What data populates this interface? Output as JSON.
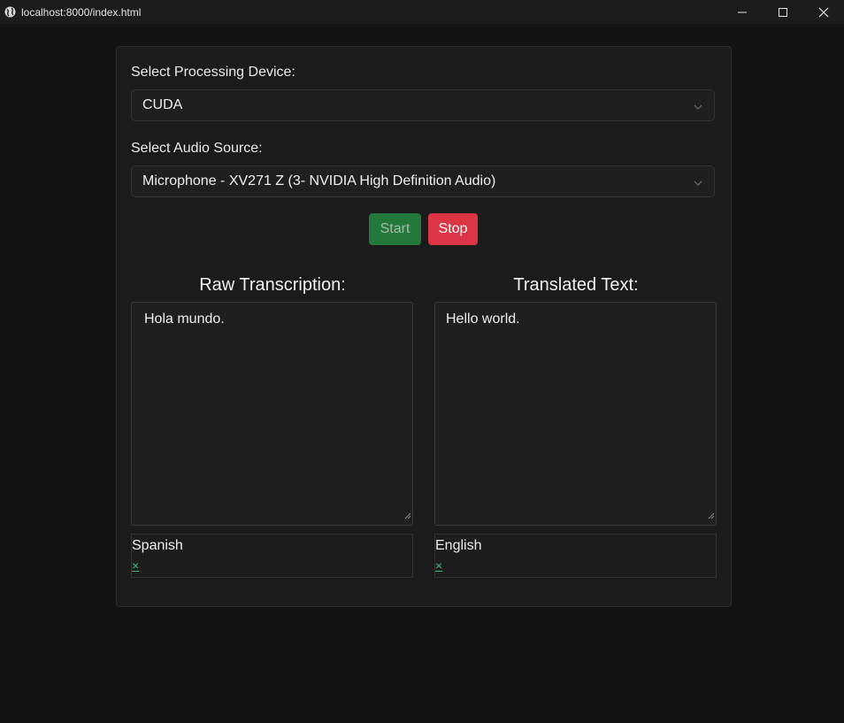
{
  "window": {
    "title": "localhost:8000/index.html",
    "icon": "globe-icon"
  },
  "device": {
    "label": "Select Processing Device:",
    "selected": "CUDA"
  },
  "audio": {
    "label": "Select Audio Source:",
    "selected": "Microphone - XV271 Z (3- NVIDIA High Definition Audio)"
  },
  "controls": {
    "start_label": "Start",
    "stop_label": "Stop",
    "start_color": "#23793c",
    "stop_color": "#dc3545"
  },
  "raw": {
    "heading": "Raw Transcription:",
    "text": "Hola mundo.",
    "language": "Spanish",
    "remove": "×"
  },
  "translated": {
    "heading": "Translated Text:",
    "text": "Hello world.",
    "language": "English",
    "remove": "×"
  }
}
